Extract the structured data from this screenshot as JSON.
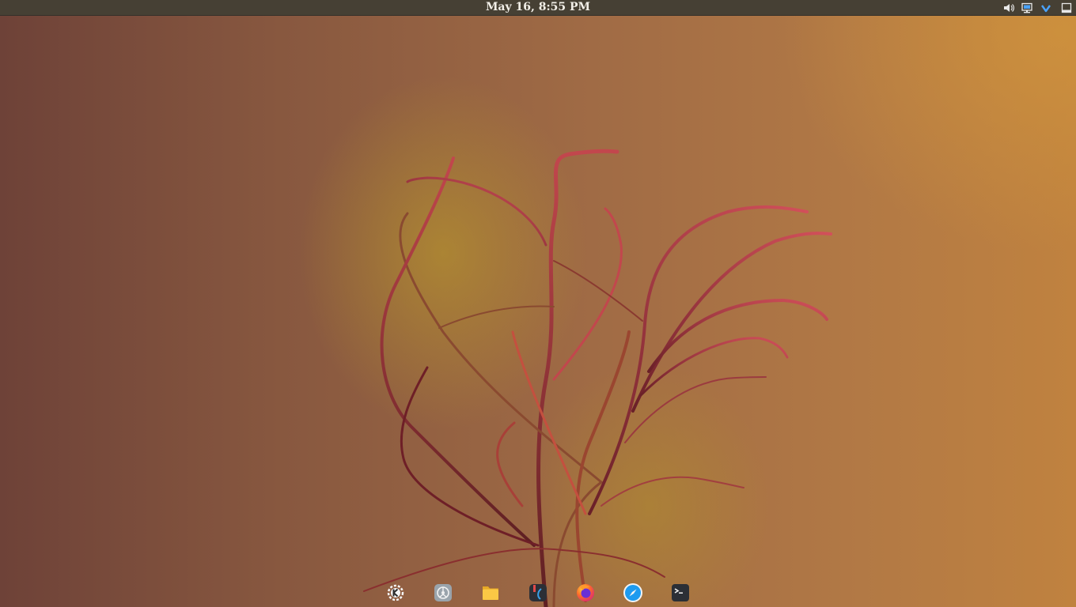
{
  "panel": {
    "clock": "May 16, 8:55 PM",
    "tray": [
      {
        "name": "volume-icon"
      },
      {
        "name": "network-icon"
      },
      {
        "name": "notifications-icon"
      },
      {
        "name": "show-desktop-icon"
      }
    ]
  },
  "dock": {
    "items": [
      {
        "name": "kde-plasma-launcher",
        "icon": "kde-logo"
      },
      {
        "name": "system-settings",
        "icon": "settings-gear"
      },
      {
        "name": "file-manager",
        "icon": "folder"
      },
      {
        "name": "kdevelop",
        "icon": "ide"
      },
      {
        "name": "firefox",
        "icon": "firefox-logo"
      },
      {
        "name": "web-browser",
        "icon": "compass"
      },
      {
        "name": "terminal",
        "icon": "terminal-prompt"
      }
    ]
  },
  "colors": {
    "panel_bg": "#464034",
    "clock_text": "#f2efe8",
    "tray_accent": "#4aa3ff"
  }
}
